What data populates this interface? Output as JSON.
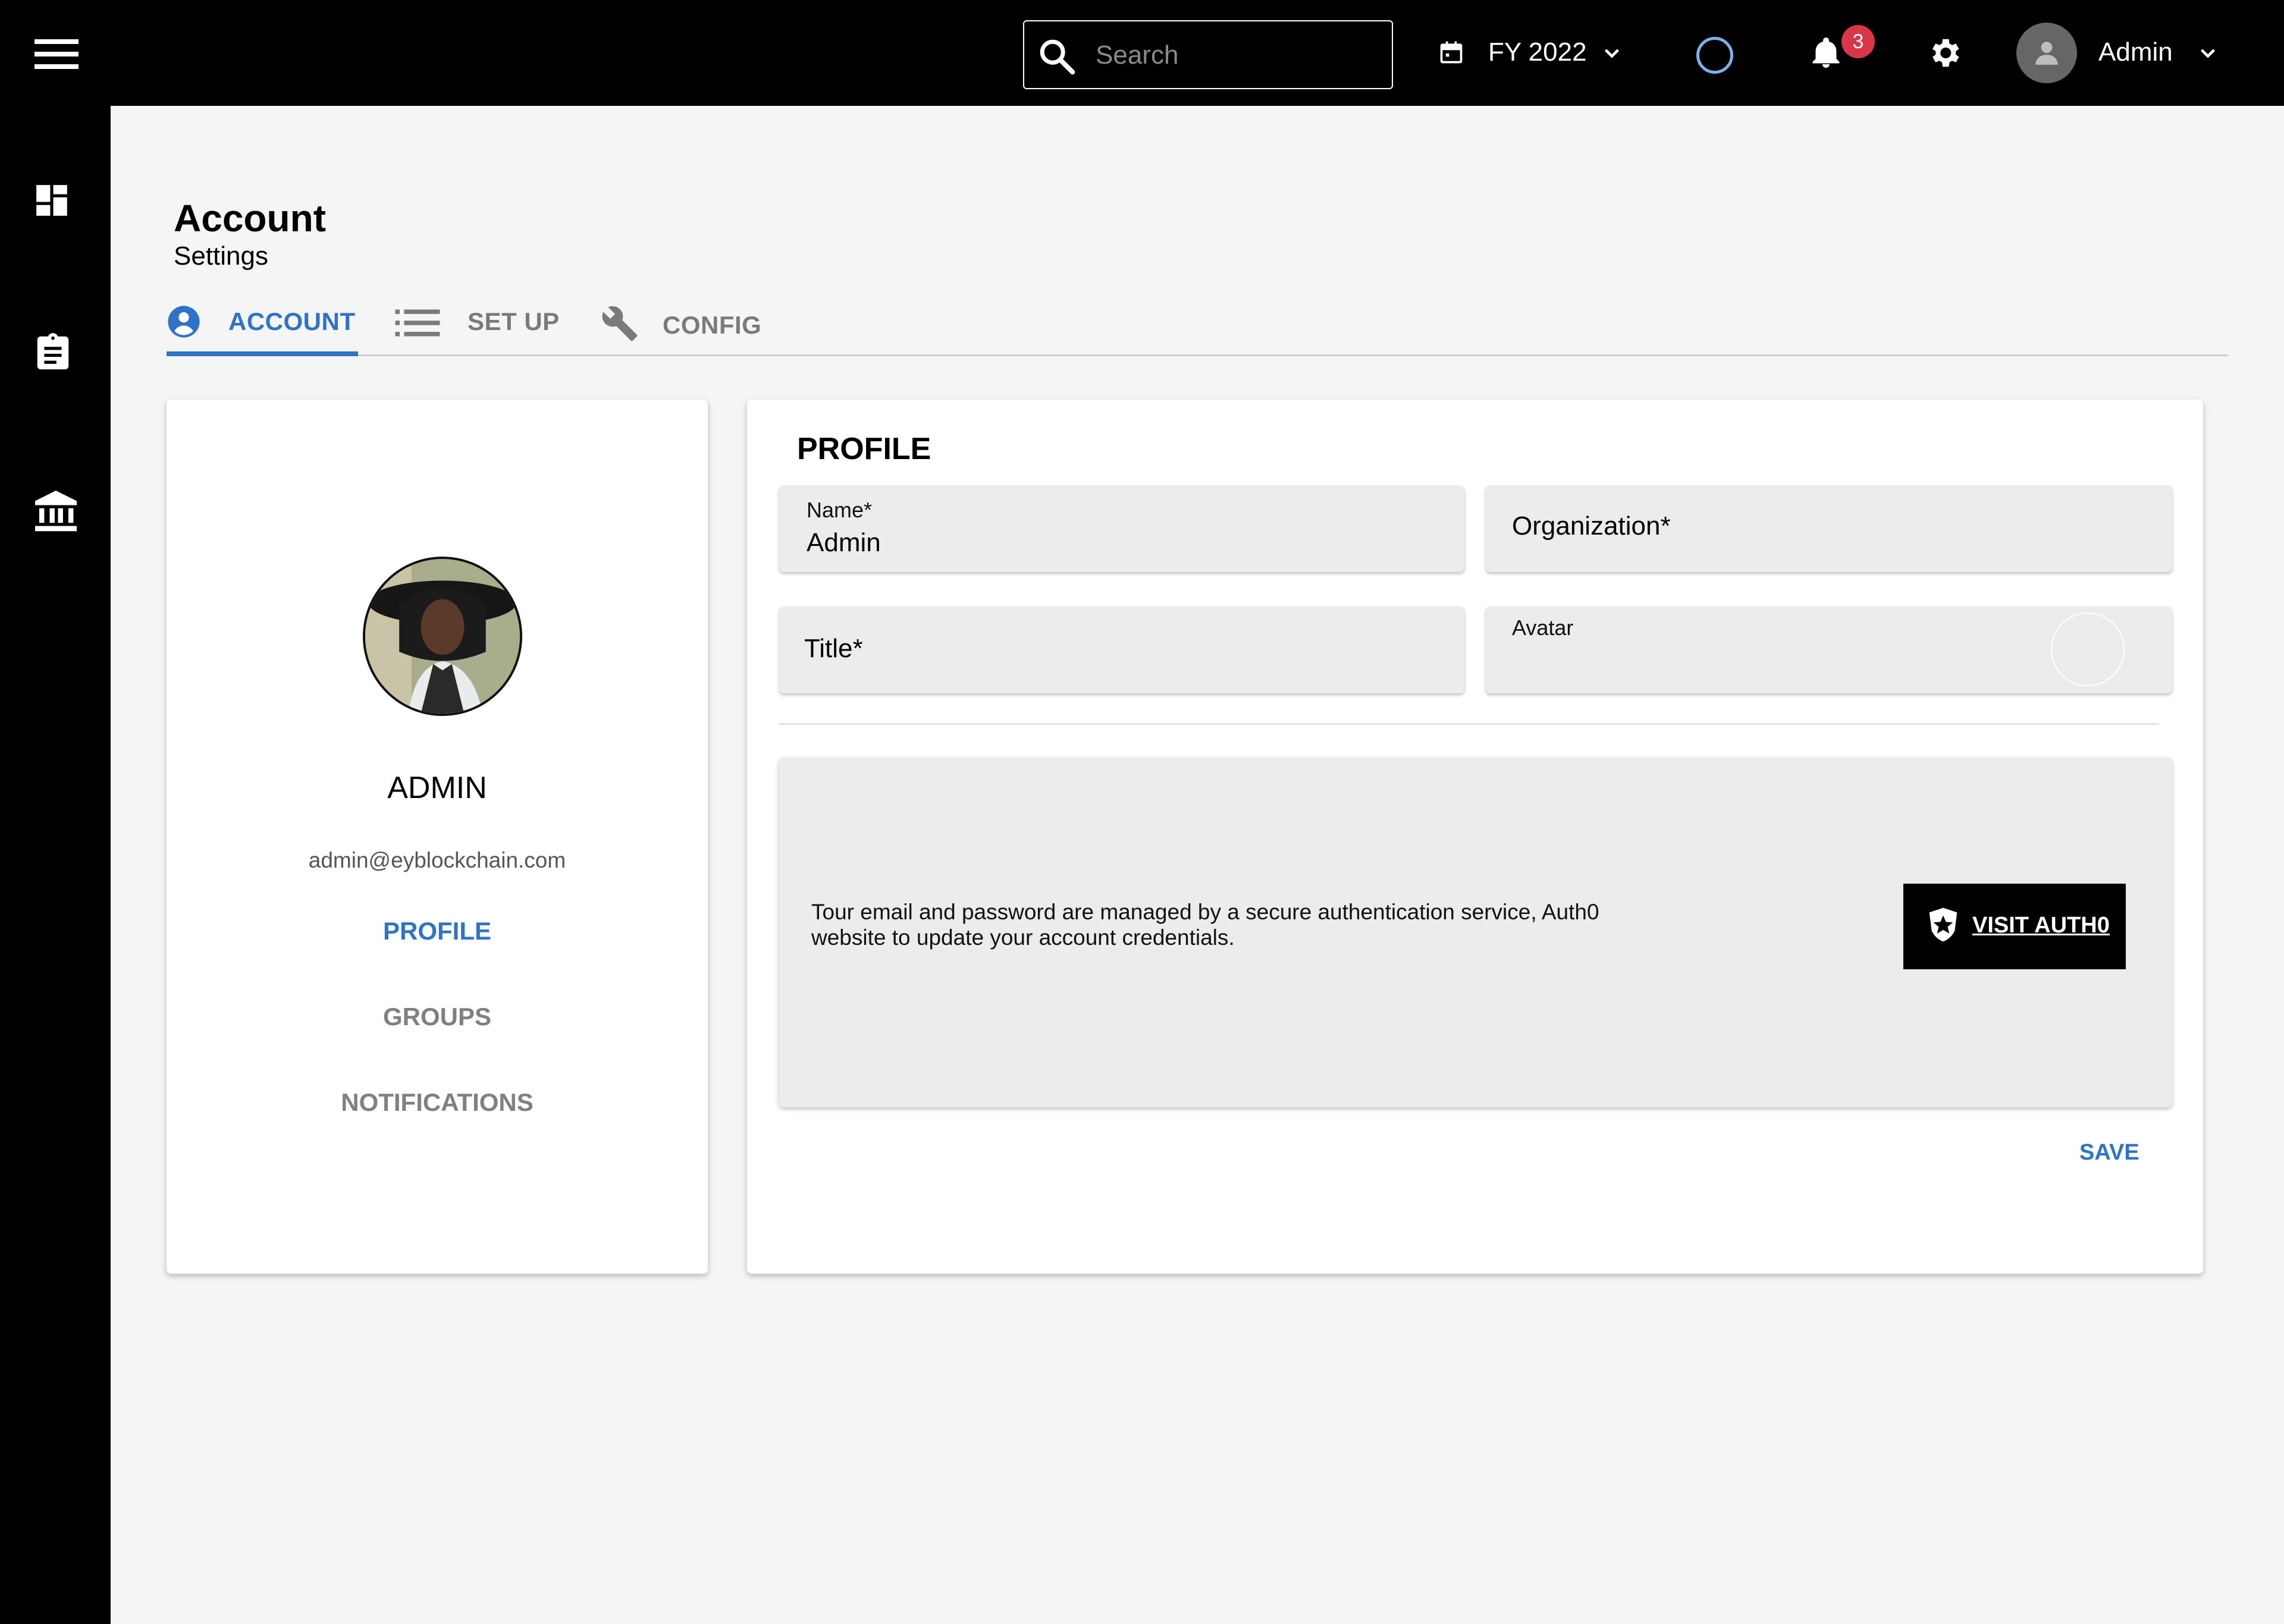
{
  "topbar": {
    "search_placeholder": "Search",
    "fiscal_year": "FY 2022",
    "notification_count": "3",
    "user_name": "Admin"
  },
  "sidebar": {
    "icons": [
      "dashboard-icon",
      "clipboard-icon",
      "bank-icon"
    ]
  },
  "header": {
    "title": "Account",
    "subtitle": "Settings"
  },
  "tabs": [
    {
      "label": "ACCOUNT",
      "icon": "account-circle-icon",
      "active": true
    },
    {
      "label": "SET UP",
      "icon": "list-icon",
      "active": false
    },
    {
      "label": "CONFIG",
      "icon": "wrench-icon",
      "active": false
    }
  ],
  "profile_card": {
    "name": "ADMIN",
    "email": "admin@eyblockchain.com",
    "nav": [
      {
        "label": "PROFILE",
        "active": true
      },
      {
        "label": "GROUPS",
        "active": false
      },
      {
        "label": "NOTIFICATIONS",
        "active": false
      }
    ]
  },
  "profile_form": {
    "heading": "PROFILE",
    "name_label": "Name*",
    "name_value": "Admin",
    "organization_label": "Organization*",
    "title_label": "Title*",
    "avatar_label": "Avatar",
    "auth_message": "Tour email and password are managed by a secure authentication service, Auth0 website to update your account credentials.",
    "visit_button": "VISIT AUTH0",
    "save_button": "SAVE"
  },
  "colors": {
    "accent": "#2f73c8",
    "badge": "#d9364a",
    "topbar": "#000000",
    "background": "#f5f5f5"
  }
}
